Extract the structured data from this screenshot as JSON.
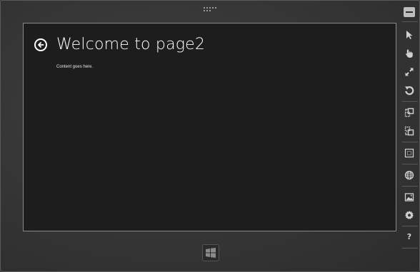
{
  "app": {
    "page_title": "Welcome to page2",
    "content_text": "Content goes here."
  },
  "toolbar": {
    "items": [
      {
        "icon": "minimize-icon"
      },
      {
        "icon": "pointer-icon"
      },
      {
        "icon": "touch-icon"
      },
      {
        "icon": "pinch-zoom-icon"
      },
      {
        "icon": "rotate-icon"
      },
      {
        "icon": "rotate-clockwise-icon"
      },
      {
        "icon": "rotate-counterclockwise-icon"
      },
      {
        "icon": "resolution-icon"
      },
      {
        "icon": "location-icon"
      },
      {
        "icon": "screenshot-icon"
      },
      {
        "icon": "settings-icon"
      },
      {
        "icon": "help-icon"
      }
    ],
    "help_label": "?"
  },
  "colors": {
    "frame": "#353535",
    "screen": "#1d1d1d",
    "text": "#ffffff",
    "icon": "#d0d0d0"
  }
}
